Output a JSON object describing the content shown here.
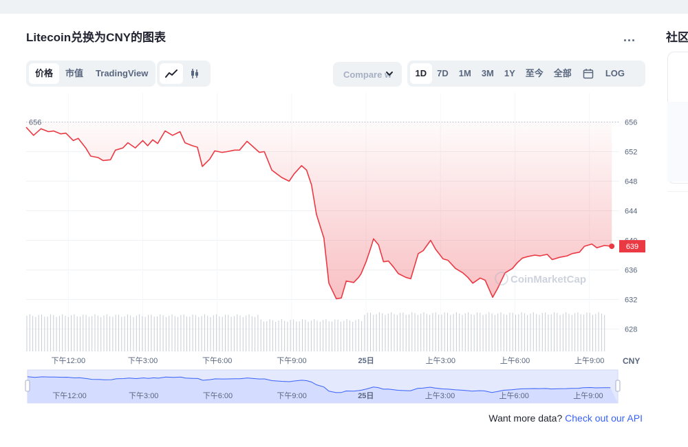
{
  "title": "Litecoin兑换为CNY的图表",
  "more_label": "...",
  "side_title": "社区",
  "tabs": [
    {
      "label": "价格",
      "active": true
    },
    {
      "label": "市值",
      "active": false
    },
    {
      "label": "TradingView",
      "active": false
    }
  ],
  "chart_type_icons": [
    {
      "icon": "line-chart-icon",
      "active": true
    },
    {
      "icon": "candlestick-icon",
      "active": false
    }
  ],
  "compare": {
    "label": "Compare w"
  },
  "ranges": [
    {
      "label": "1D",
      "active": true
    },
    {
      "label": "7D",
      "active": false
    },
    {
      "label": "1M",
      "active": false
    },
    {
      "label": "3M",
      "active": false
    },
    {
      "label": "1Y",
      "active": false
    },
    {
      "label": "至今",
      "active": false
    },
    {
      "label": "全部",
      "active": false
    }
  ],
  "calendar_icon": "calendar-icon",
  "log_label": "LOG",
  "watermark": "CoinMarketCap",
  "footer": {
    "text": "Want more data?",
    "link": "Check out our API"
  },
  "chart_data": {
    "type": "area",
    "currency": "CNY",
    "color_line": "#ea3943",
    "ylim": [
      626,
      658
    ],
    "yticks": [
      628,
      632,
      636,
      640,
      644,
      648,
      652,
      656
    ],
    "open_label": "656",
    "open_value": 656,
    "last_label": "639",
    "last_value": 639.2,
    "xlim": [
      0,
      23.9
    ],
    "xticks": [
      {
        "x": 1.7,
        "label": "下午12:00"
      },
      {
        "x": 4.7,
        "label": "下午3:00"
      },
      {
        "x": 7.7,
        "label": "下午6:00"
      },
      {
        "x": 10.7,
        "label": "下午9:00"
      },
      {
        "x": 13.7,
        "label": "25日"
      },
      {
        "x": 16.7,
        "label": "上午3:00"
      },
      {
        "x": 19.7,
        "label": "上午6:00"
      },
      {
        "x": 22.7,
        "label": "上午9:00"
      }
    ],
    "series": [
      {
        "x": [
          0,
          0.3,
          0.6,
          0.9,
          1.1,
          1.4,
          1.6,
          1.9,
          2.1,
          2.4,
          2.6,
          2.9,
          3.1,
          3.4,
          3.6,
          3.9,
          4.1,
          4.4,
          4.7,
          4.9,
          5.1,
          5.3,
          5.6,
          5.9,
          6.2,
          6.4,
          6.7,
          6.9,
          7.1,
          7.4,
          7.6,
          7.9,
          8.1,
          8.4,
          8.6,
          8.9,
          9.1,
          9.4,
          9.6,
          9.9,
          10.1,
          10.3,
          10.6,
          10.8,
          11.1,
          11.3,
          11.5,
          11.7,
          12.0,
          12.2,
          12.5,
          12.7,
          12.9,
          13.2,
          13.4,
          13.5,
          13.7,
          13.9,
          14.0,
          14.2,
          14.4,
          14.6,
          14.8,
          15.0,
          15.3,
          15.5,
          15.8,
          16.0,
          16.3,
          16.5,
          16.8,
          17.0,
          17.3,
          17.6,
          17.8,
          18.0,
          18.3,
          18.5,
          18.8,
          19.0,
          19.3,
          19.6,
          19.8,
          20.0,
          20.2,
          20.5,
          20.7,
          21.0,
          21.2,
          21.5,
          21.8,
          22.0,
          22.3,
          22.5,
          22.8,
          23.0,
          23.3,
          23.6
        ],
        "y": [
          655.3,
          654.2,
          655.1,
          654.7,
          654.8,
          654.4,
          654.5,
          653.5,
          653.8,
          652.5,
          651.4,
          651.2,
          650.8,
          650.9,
          652.2,
          652.5,
          653.2,
          652.5,
          653.5,
          652.8,
          653.6,
          653.1,
          654.8,
          654.2,
          654.7,
          653.2,
          652.8,
          652.6,
          650.0,
          651.0,
          652.1,
          651.9,
          652.0,
          652.2,
          652.2,
          653.4,
          652.8,
          651.9,
          652.0,
          649.5,
          649.0,
          648.5,
          648.0,
          649.0,
          650.1,
          649.5,
          647.5,
          643.5,
          640.3,
          634.2,
          632.1,
          632.2,
          634.5,
          634.3,
          635.0,
          635.5,
          637.1,
          639.1,
          640.2,
          639.4,
          637.1,
          637.2,
          636.4,
          635.5,
          635.0,
          634.8,
          638.2,
          638.6,
          640.0,
          638.8,
          637.5,
          637.3,
          636.2,
          635.6,
          635.0,
          634.2,
          634.9,
          634.6,
          632.3,
          633.5,
          635.6,
          636.2,
          637.0,
          637.6,
          637.8,
          638.0,
          637.9,
          638.1,
          637.4,
          637.7,
          637.9,
          638.2,
          638.4,
          639.2,
          639.5,
          639.0,
          639.3,
          639.2
        ]
      }
    ]
  }
}
